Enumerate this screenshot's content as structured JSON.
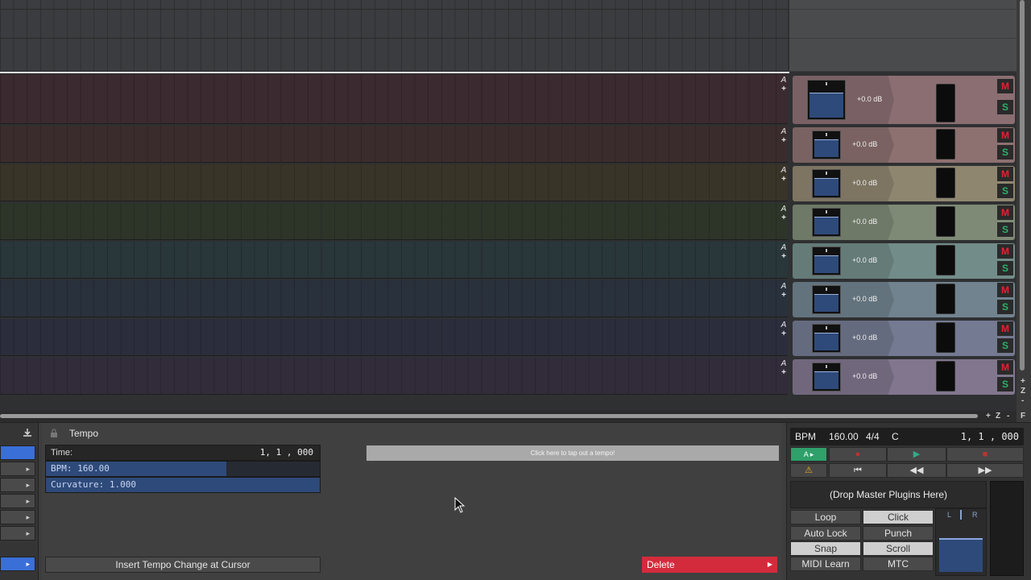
{
  "tracks": [
    {
      "color": "#3b2a2f",
      "strip": "#8a6e72",
      "gain": "+0.0 dB",
      "mute": "M",
      "solo": "S",
      "auto": "A",
      "add": "+"
    },
    {
      "color": "#3a2c2d",
      "strip": "#8d7070",
      "gain": "+0.0 dB",
      "mute": "M",
      "solo": "S",
      "auto": "A",
      "add": "+"
    },
    {
      "color": "#393428",
      "strip": "#8f8670",
      "gain": "+0.0 dB",
      "mute": "M",
      "solo": "S",
      "auto": "A",
      "add": "+"
    },
    {
      "color": "#2d3529",
      "strip": "#7e8a76",
      "gain": "+0.0 dB",
      "mute": "M",
      "solo": "S",
      "auto": "A",
      "add": "+"
    },
    {
      "color": "#29363a",
      "strip": "#728c89",
      "gain": "+0.0 dB",
      "mute": "M",
      "solo": "S",
      "auto": "A",
      "add": "+"
    },
    {
      "color": "#29313c",
      "strip": "#71838f",
      "gain": "+0.0 dB",
      "mute": "M",
      "solo": "S",
      "auto": "A",
      "add": "+"
    },
    {
      "color": "#2b2d3c",
      "strip": "#737a91",
      "gain": "+0.0 dB",
      "mute": "M",
      "solo": "S",
      "auto": "A",
      "add": "+"
    },
    {
      "color": "#322c3a",
      "strip": "#81768e",
      "gain": "+0.0 dB",
      "mute": "M",
      "solo": "S",
      "auto": "A",
      "add": "+"
    }
  ],
  "zoom": {
    "plus": "+",
    "z": "Z",
    "minus": "-",
    "f": "F"
  },
  "tempo": {
    "title": "Tempo",
    "time_label": "Time:",
    "time_value": "1, 1 , 000",
    "bpm_text": "BPM: 160.00",
    "bpm_fill": 0.66,
    "curvature_text": "Curvature: 1.000",
    "tap_label": "Click here to tap out a tempo!",
    "insert_label": "Insert Tempo Change at Cursor",
    "delete_label": "Delete",
    "delete_arrow": "▶"
  },
  "transport": {
    "bpm_label": "BPM",
    "bpm_value": "160.00",
    "meter": "4/4",
    "key": "C",
    "position": "1, 1 , 000",
    "drop_plugins": "(Drop Master Plugins Here)",
    "pan_left": "L",
    "pan_right": "R",
    "buttons": {
      "loop": "Loop",
      "click": "Click",
      "auto_lock": "Auto Lock",
      "punch": "Punch",
      "snap": "Snap",
      "scroll": "Scroll",
      "midi_learn": "MIDI Learn",
      "mtc": "MTC"
    },
    "controls": {
      "play_mode": "A ▸",
      "record": "●",
      "play": "▶",
      "stop": "■",
      "warning": "⚠",
      "to_start": "⏮",
      "rewind": "◀◀",
      "forward": "▶▶"
    }
  }
}
